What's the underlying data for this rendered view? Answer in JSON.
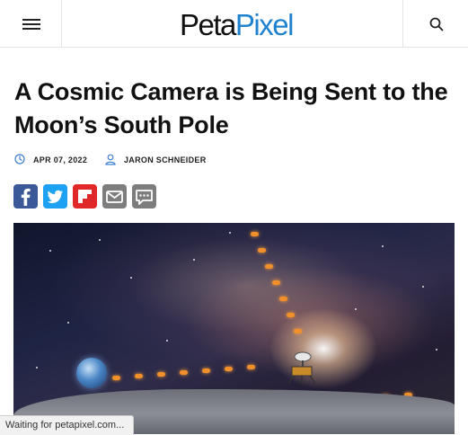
{
  "header": {
    "logo_part1": "Peta",
    "logo_part2": "Pixel",
    "menu_icon": "hamburger-menu-icon",
    "search_icon": "search-icon"
  },
  "article": {
    "title": "A Cosmic Camera is Being Sent to the Moon’s South Pole",
    "date": "APR 07, 2022",
    "author": "JARON SCHNEIDER"
  },
  "share_buttons": [
    {
      "icon": "facebook-icon",
      "color": "#3b5998"
    },
    {
      "icon": "twitter-icon",
      "color": "#1da1f2"
    },
    {
      "icon": "flipboard-icon",
      "color": "#e12828"
    },
    {
      "icon": "email-icon",
      "color": "#7d7d7d"
    },
    {
      "icon": "comment-icon",
      "color": "#7d7d7d"
    }
  ],
  "status_bar": {
    "text": "Waiting for petapixel.com..."
  },
  "colors": {
    "brand_blue": "#1f82cf",
    "meta_icon_blue": "#3d7fd1"
  }
}
